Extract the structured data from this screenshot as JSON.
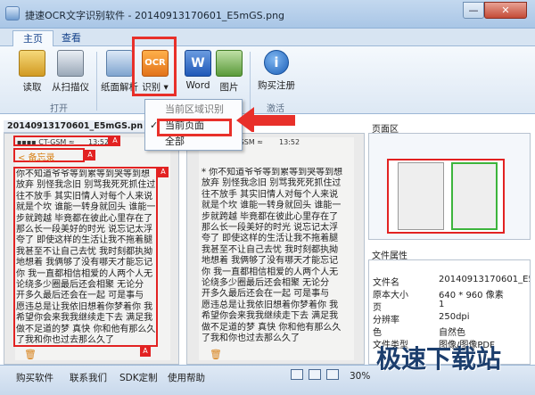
{
  "window": {
    "title": "捷速OCR文字识别软件 - 20140913170601_E5mGS.png",
    "minimize": "—",
    "close": "✕"
  },
  "tabs": [
    {
      "label": "主页"
    },
    {
      "label": "查看"
    }
  ],
  "ribbon": {
    "read": "读取",
    "scan": "从扫描仪",
    "paper": "纸面解析",
    "ocr": "识别",
    "ocr_icon_text": "OCR",
    "word": "Word",
    "image": "图片",
    "buy": "购买注册",
    "groups": {
      "open": "打开",
      "activate": "激活"
    }
  },
  "ocr_menu": {
    "items": [
      {
        "label": "当前区域识别"
      },
      {
        "label": "当前页面",
        "checked": true
      },
      {
        "label": "全部"
      }
    ]
  },
  "left_pane": {
    "file_label": "20140913170601_E5mGS.pn",
    "status_left": "▪▪▪▪ CT-GSM ≈",
    "status_time": "13:52",
    "back_text": "< 备忘录",
    "lines": [
      "你不知道爷爷等到累等到哭等到想",
      "放弃 别怪我念旧 别骂我死死抓住过",
      "往不放手 其实旧情人对每个人来说",
      "就是个坎 谁能一转身就回头 谁能一",
      "步就跨越 毕竟都在彼此心里存在了",
      "那么长一段美好的时光 说忘记太浮",
      "夸了 即使这样的生活让我不拖着腿",
      "我甚至不让自己去忧 我时刻都执拗",
      "地想着 我俩够了没有哪天才能忘记",
      "你 我一直都相信相爱的人两个人无",
      "论绕多少圈最后还会相聚 无论分",
      "开多久最后还会在一起 可是事与",
      "愿违总是让我依旧想着你梦着你 我",
      "希望你会来我我继续走下去 满足我",
      "做不足道的梦 真快 你和他有那么久",
      "了我和你也过去那么久了"
    ]
  },
  "mid_pane": {
    "status_left": "▪▪▪▪▪ CT-GSM ≈",
    "status_time": "13:52",
    "lines": [
      "* 你不知道爷爷等到累等到哭等到想",
      "放弃 别怪我念旧 别骂我死死抓住过",
      "往不放手 其实旧情人对每个人来说",
      "就是个坎 谁能一转身就回头 谁能一",
      "步就跨越 毕竟都在彼此心里存在了",
      "那么长一段美好的时光 说忘记太浮",
      "夸了 即使这样的生活让我不拖着腿",
      "我甚至不让自己去忧 我时刻都执拗",
      "地想着 我俩够了没有哪天才能忘记",
      "你 我一直都相信相爱的人两个人无",
      "论绕多少圈最后还会相聚 无论分",
      "开多久最后还会在一起 可是事与",
      "愿违总是让我依旧想着你梦着你 我",
      "希望你会来我我继续走下去 满足我",
      "做不足道的梦 真快 你和他有那么久",
      "了我和你也过去那么久了"
    ]
  },
  "page_area": {
    "title": "页面区"
  },
  "file_props": {
    "title": "文件属性",
    "rows": [
      {
        "key": "文件名",
        "value": "20140913170601_E5..."
      },
      {
        "key": "原本大小",
        "value": "640 * 960 像素"
      },
      {
        "key": "页",
        "value": "1"
      },
      {
        "key": "分辨率",
        "value": "250dpi"
      },
      {
        "key": "色",
        "value": "自然色"
      },
      {
        "key": "文件类型",
        "value": "图像/图像PDF"
      }
    ]
  },
  "statusbar": {
    "items": [
      "购买软件",
      "联系我们",
      "SDK定制",
      "使用帮助"
    ],
    "zoom": "30%"
  },
  "watermark": "极速下载站",
  "colors": {
    "accent": "#e8302a",
    "ribbon": "#dde8f4"
  }
}
